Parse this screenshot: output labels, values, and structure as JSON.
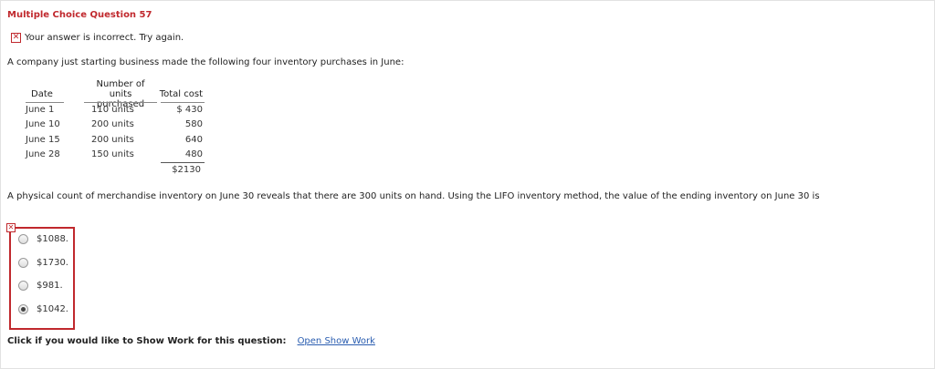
{
  "question": {
    "title": "Multiple Choice Question 57",
    "feedback": "Your answer is incorrect.  Try again.",
    "prompt": "A company just starting business made the following four inventory purchases in June:",
    "followup": "A physical count of merchandise inventory on June 30 reveals that there are 300 units on hand. Using the LIFO inventory method, the value of the ending inventory on June 30 is"
  },
  "table": {
    "headers": {
      "date": "Date",
      "units_line1": "Number of units",
      "units_line2": "purchased",
      "cost": "Total cost"
    },
    "rows": [
      {
        "date": "June  1",
        "units": "110 units",
        "cost": "$ 430"
      },
      {
        "date": "June 10",
        "units": "200 units",
        "cost": "580"
      },
      {
        "date": "June 15",
        "units": "200 units",
        "cost": "640"
      },
      {
        "date": "June 28",
        "units": "150 units",
        "cost": "480"
      }
    ],
    "total": "$2130"
  },
  "options": [
    {
      "label": "$1088.",
      "selected": false
    },
    {
      "label": "$1730.",
      "selected": false
    },
    {
      "label": "$981.",
      "selected": false
    },
    {
      "label": "$1042.",
      "selected": true
    }
  ],
  "show_work": {
    "label": "Click if you would like to Show Work for this question:",
    "link": "Open Show Work"
  },
  "colors": {
    "error": "#c0282d",
    "link": "#2a5db0"
  },
  "icons": {
    "incorrect": "x-mark-icon"
  }
}
